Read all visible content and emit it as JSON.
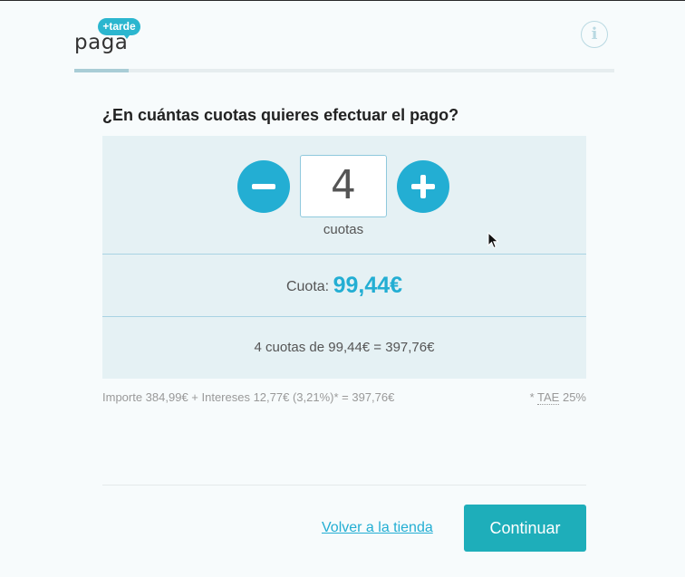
{
  "brand": {
    "word": "paga",
    "badge": "+tarde",
    "color": "#2bb6cf"
  },
  "header": {
    "info_icon": "i",
    "progress": 0.1
  },
  "question": "¿En cuántas cuotas quieres efectuar el pago?",
  "stepper": {
    "value": "4",
    "unit_label": "cuotas",
    "accent": "#23aed3"
  },
  "cuota": {
    "label": "Cuota:",
    "value": "99,44€"
  },
  "total": "4 cuotas de 99,44€ = 397,76€",
  "footnote": "Importe 384,99€ + Intereses 12,77€ (3,21%)* = 397,76€",
  "tae": {
    "prefix": "* ",
    "label": "TAE",
    "value": " 25%"
  },
  "actions": {
    "back_label": "Volver a la tienda",
    "continue_label": "Continuar",
    "continue_color": "#1eaeba"
  }
}
